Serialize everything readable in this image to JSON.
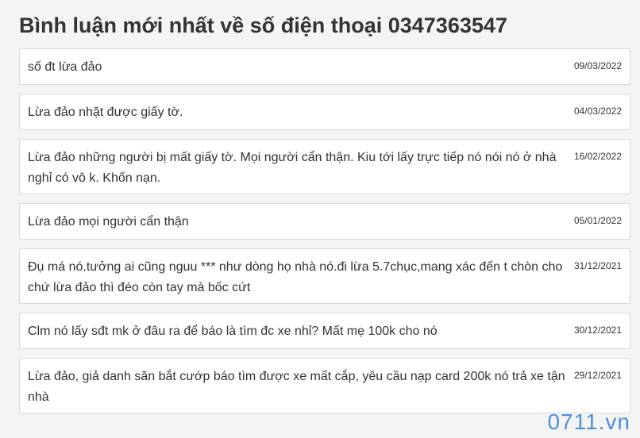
{
  "page": {
    "title": "Bình luận mới nhất về số điện thoại 0347363547"
  },
  "comments": [
    {
      "text": "số đt lừa đảo",
      "date": "09/03/2022"
    },
    {
      "text": "Lừa đảo nhặt được giấy tờ.",
      "date": "04/03/2022"
    },
    {
      "text": "Lừa đảo những người bị mất giấy tờ. Mọi người cẩn thận. Kiu tới lấy trực tiếp nó nói nó ở nhà nghỉ có vô k. Khốn nạn.",
      "date": "16/02/2022"
    },
    {
      "text": "Lừa đảo mọi người cẩn thận",
      "date": "05/01/2022"
    },
    {
      "text": "Đụ má nó.tưởng ai cũng nguu *** như dòng họ nhà nó.đi lừa 5.7chục,mang xác đến t chòn cho chứ lừa đảo thì đéo còn tay mà bốc cứt",
      "date": "31/12/2021"
    },
    {
      "text": "Clm nó lấy sđt mk ở đâu ra để báo là tìm đc xe nhỉ? Mất mẹ 100k cho nó",
      "date": "30/12/2021"
    },
    {
      "text": "Lừa đảo, giả danh săn bắt cướp báo tìm được xe mất cắp, yêu cầu nạp card 200k nó trả xe tận nhà",
      "date": "29/12/2021"
    }
  ],
  "watermark": {
    "text": "0711.vn",
    "color": "#4f8fe0"
  }
}
